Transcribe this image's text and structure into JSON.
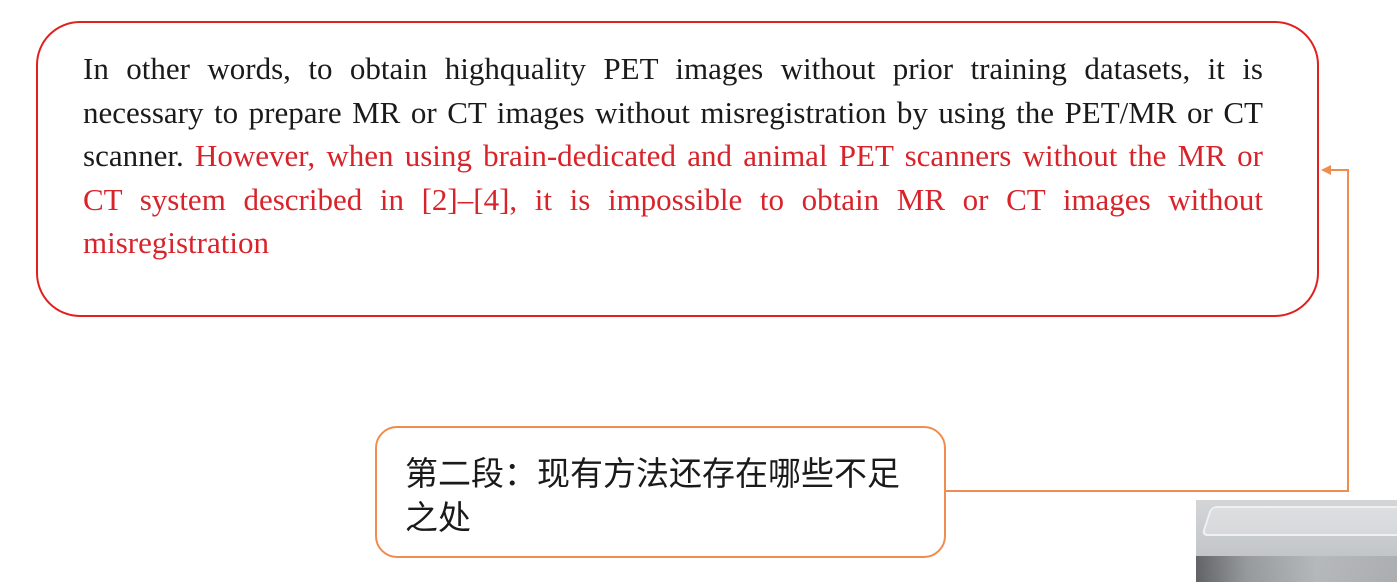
{
  "quote": {
    "text_black": "In other words, to obtain highquality PET images without prior training datasets, it is necessary to prepare MR or CT images without misregistration by using the PET/MR or CT scanner.",
    "text_red": "However, when using brain-dedicated and animal PET scanners without the MR or CT system described in [2]–[4], it is impossible to obtain MR or CT images without misregistration",
    "highlight_color": "#d8232a",
    "border_color": "#e0201c"
  },
  "note": {
    "text": "第二段：现有方法还存在哪些不足之处",
    "border_color": "#ee8d4f"
  },
  "connector": {
    "color": "#ee8d4f"
  }
}
